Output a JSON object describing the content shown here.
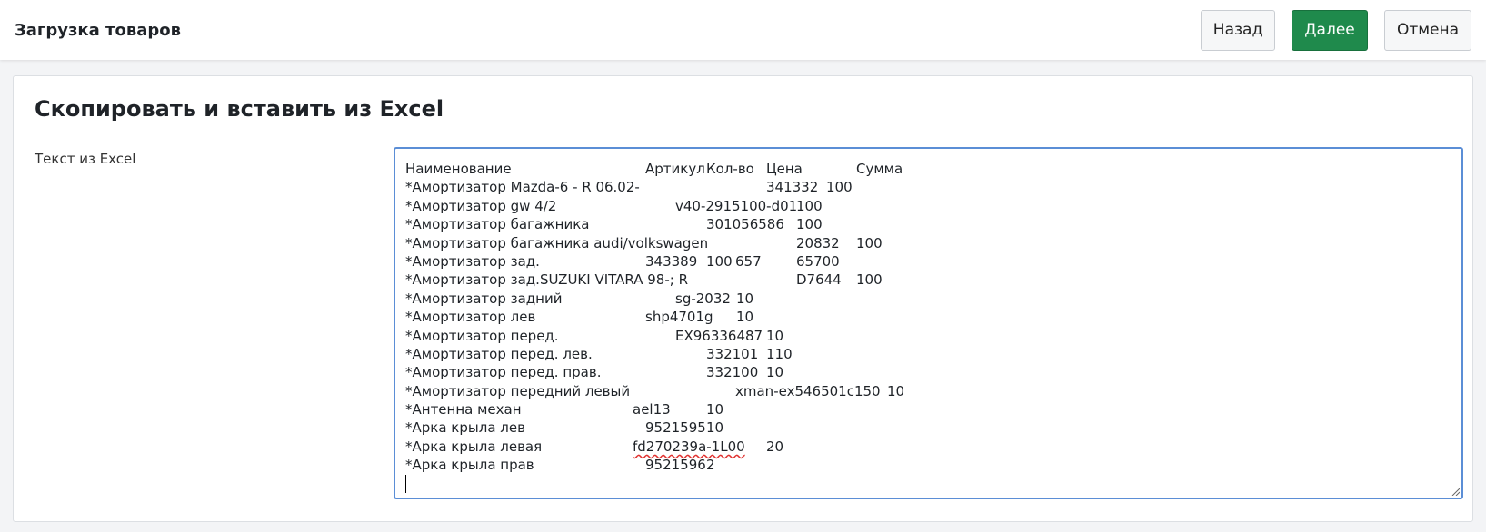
{
  "header": {
    "title": "Загрузка товаров",
    "back_label": "Назад",
    "next_label": "Далее",
    "cancel_label": "Отмена"
  },
  "card": {
    "title": "Скопировать и вставить из Excel",
    "field_label": "Текст из Excel"
  },
  "textarea": {
    "rows": [
      [
        "Наименование",
        "Артикул",
        "Кол-во",
        "Цена",
        "Сумма"
      ],
      [
        "*Амортизатор Mazda-6 - R 06.02-",
        "341332",
        "100"
      ],
      [
        "*Амортизатор gw 4/2",
        "v40-2915100-d01",
        "100"
      ],
      [
        "*Амортизатор багажника",
        "301056586",
        "100"
      ],
      [
        "*Амортизатор багажника audi/volkswagen",
        "20832",
        "100"
      ],
      [
        "*Амортизатор зад.",
        "343389",
        "100",
        "657",
        "65700"
      ],
      [
        "*Амортизатор зад.SUZUKI VITARA 98-; R",
        "D7644",
        "100"
      ],
      [
        "*Амортизатор задний",
        "sg-2032",
        "10"
      ],
      [
        "*Амортизатор лев",
        "shp4701g",
        "10"
      ],
      [
        "*Амортизатор перед.",
        "EX96336487",
        "10"
      ],
      [
        "*Амортизатор перед. лев.",
        "332101",
        "110"
      ],
      [
        "*Амортизатор перед. прав.",
        "332100",
        "10"
      ],
      [
        "*Амортизатор передний левый",
        "xman-ex546501c150",
        "10"
      ],
      [
        "*Антенна механ",
        "ael13",
        "10"
      ],
      [
        "*Арка крыла лев",
        "9521595",
        "10"
      ],
      [
        "*Арка крыла левая",
        "fd270239a-1L00",
        "20"
      ],
      [
        "*Арка крыла прав",
        "9521596",
        "2"
      ]
    ]
  },
  "colors": {
    "primary": "#1f8a4c",
    "focus_border": "#5b8ed6",
    "spell_error": "#e0312f"
  }
}
